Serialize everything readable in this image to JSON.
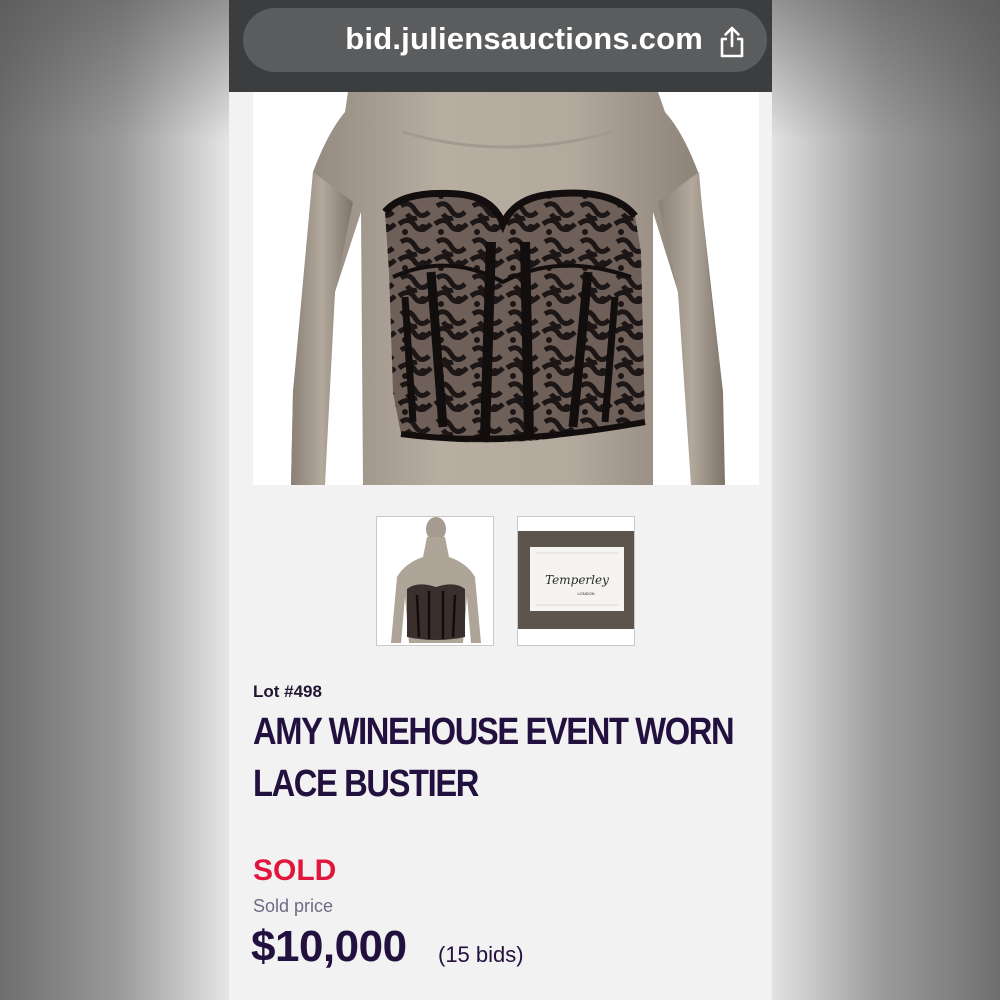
{
  "browser": {
    "url": "bid.juliensauctions.com",
    "share_icon": "share-icon"
  },
  "gallery": {
    "main_image": "lace-bustier-on-mannequin",
    "thumbnails": [
      "bustier-thumbnail",
      "label-thumbnail"
    ],
    "label_brand": "Temperley",
    "label_city": "LONDON"
  },
  "lot": {
    "number": "Lot #498",
    "title_line1": "AMY WINEHOUSE EVENT WORN",
    "title_line2": "LACE BUSTIER"
  },
  "sale": {
    "status": "SOLD",
    "price_label": "Sold price",
    "price": "$10,000",
    "bids": "(15 bids)"
  },
  "colors": {
    "title": "#22103e",
    "sold": "#e0163d",
    "address_bar": "#3b3d3e"
  }
}
